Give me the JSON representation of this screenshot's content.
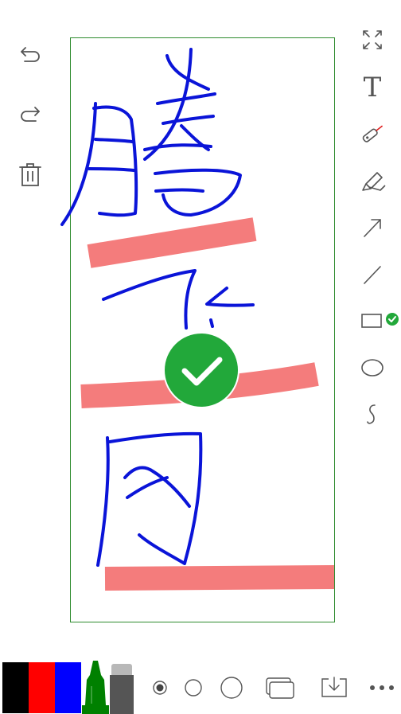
{
  "left_toolbar": {
    "undo_icon": "undo-arrow-icon",
    "redo_icon": "redo-arrow-icon",
    "delete_icon": "trash-icon"
  },
  "right_toolbar": {
    "fullscreen_icon": "expand-icon",
    "text_tool_label": "T",
    "tools": [
      "laser-pen-icon",
      "highlighter-icon",
      "arrow-line-icon",
      "straight-line-icon",
      "rectangle-icon",
      "ellipse-icon",
      "freehand-curve-icon"
    ],
    "selected_tool": "rectangle-icon"
  },
  "colors": {
    "frame": "#2e8b2e",
    "ink_blue": "#0a14d8",
    "highlight": "#f47c7c",
    "check_green": "#22a83a",
    "icon_gray": "#555555"
  },
  "palette": {
    "swatches": [
      "#000000",
      "#ff0000",
      "#0000ff",
      "#008000",
      "#555555"
    ],
    "selected": "#008000"
  },
  "bottom_toolbar": {
    "stroke_sizes": [
      "small",
      "medium",
      "large"
    ],
    "selected_stroke": "small"
  }
}
